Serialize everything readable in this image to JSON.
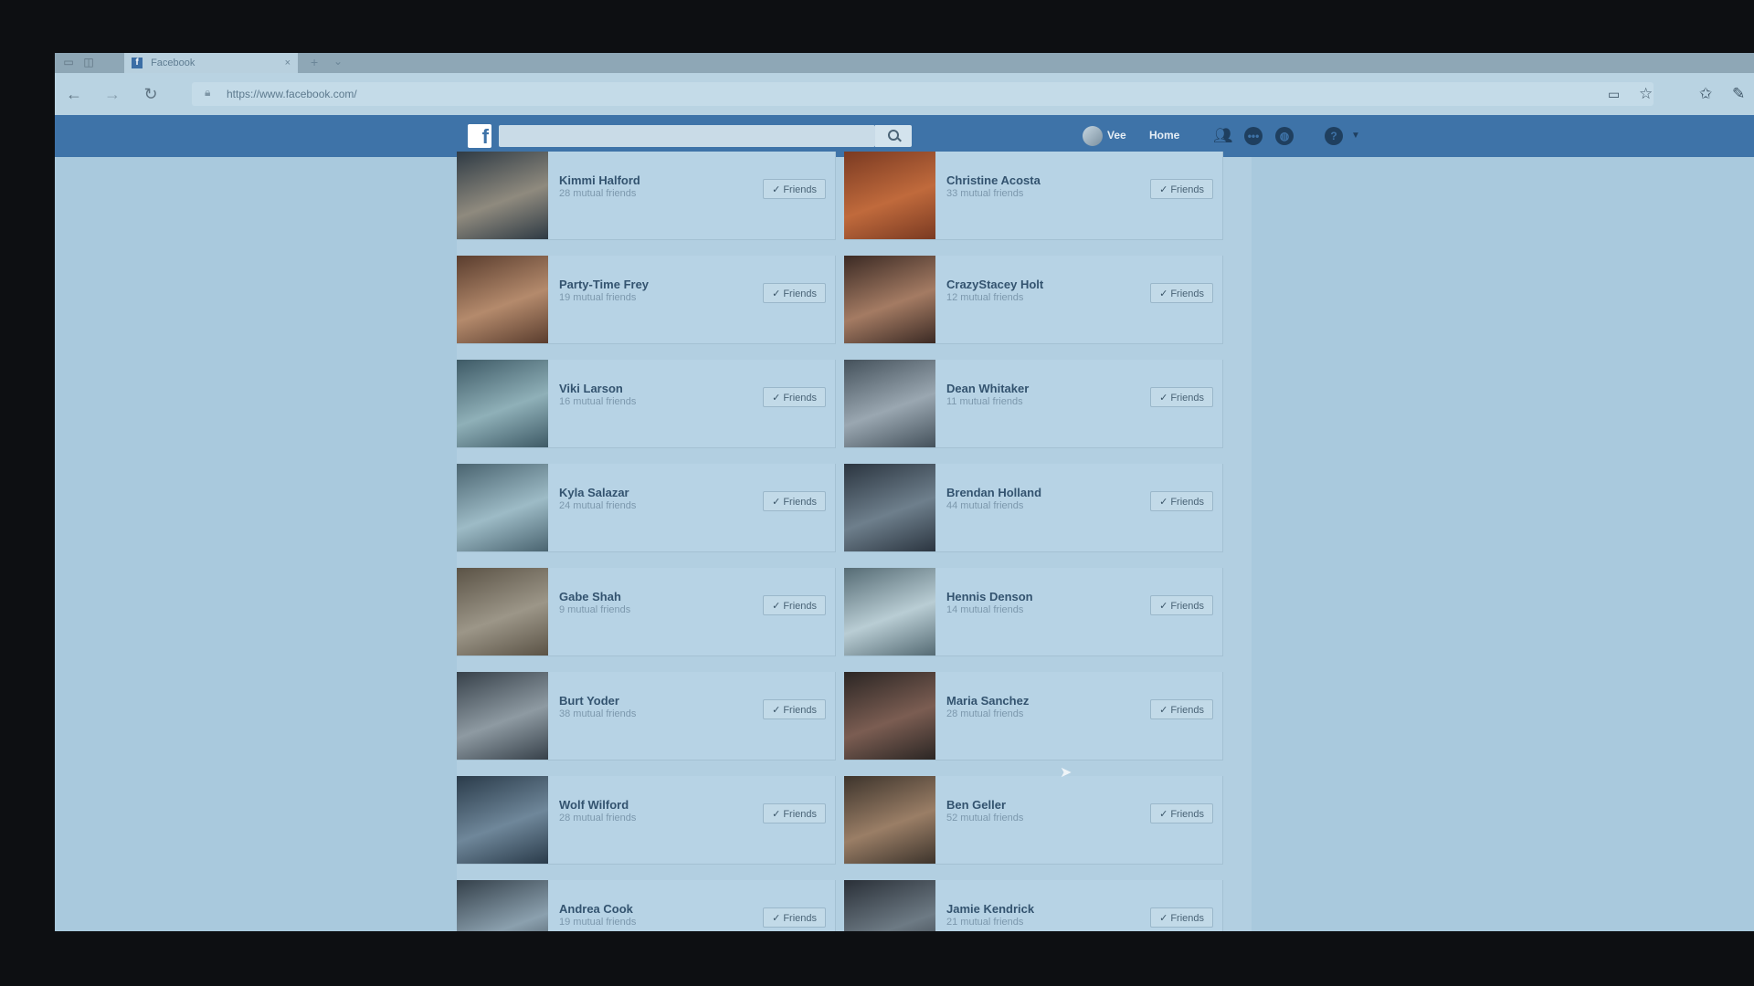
{
  "browser": {
    "tab_title": "Facebook",
    "tab_close": "×",
    "tab_new": "+",
    "tab_menu": "⌄",
    "url": "https://www.facebook.com/",
    "back": "←",
    "forward": "→",
    "reload": "↻"
  },
  "fb": {
    "logo": "f",
    "search_placeholder": "",
    "user": "Vee",
    "home": "Home"
  },
  "friends_button_label": "Friends",
  "friends": [
    {
      "name": "Kimmi Halford",
      "mutual": "28 mutual friends",
      "photo": [
        "#2e3a44",
        "#8f8a7e"
      ]
    },
    {
      "name": "Christine Acosta",
      "mutual": "33 mutual friends",
      "photo": [
        "#7a3a22",
        "#c06a3c"
      ]
    },
    {
      "name": "Party-Time Frey",
      "mutual": "19 mutual friends",
      "photo": [
        "#5a3d2e",
        "#b48a6c"
      ]
    },
    {
      "name": "CrazyStacey Holt",
      "mutual": "12 mutual friends",
      "photo": [
        "#3b2a24",
        "#a47b63"
      ]
    },
    {
      "name": "Viki Larson",
      "mutual": "16 mutual friends",
      "photo": [
        "#3e5a66",
        "#8fb0b8"
      ]
    },
    {
      "name": "Dean Whitaker",
      "mutual": "11 mutual friends",
      "photo": [
        "#44515b",
        "#9aa7b1"
      ]
    },
    {
      "name": "Kyla Salazar",
      "mutual": "24 mutual friends",
      "photo": [
        "#4a6470",
        "#9dbbc6"
      ]
    },
    {
      "name": "Brendan Holland",
      "mutual": "44 mutual friends",
      "photo": [
        "#2b3540",
        "#6e7f8c"
      ]
    },
    {
      "name": "Gabe Shah",
      "mutual": "9 mutual friends",
      "photo": [
        "#5b5346",
        "#9c9688"
      ]
    },
    {
      "name": "Hennis Denson",
      "mutual": "14 mutual friends",
      "photo": [
        "#556b74",
        "#b9cdd4"
      ]
    },
    {
      "name": "Burt Yoder",
      "mutual": "38 mutual friends",
      "photo": [
        "#37414a",
        "#8e9aa2"
      ]
    },
    {
      "name": "Maria Sanchez",
      "mutual": "28 mutual friends",
      "photo": [
        "#2b2624",
        "#7b5d52"
      ]
    },
    {
      "name": "Wolf Wilford",
      "mutual": "28 mutual friends",
      "photo": [
        "#2a3b4a",
        "#6f879a"
      ]
    },
    {
      "name": "Ben Geller",
      "mutual": "52 mutual friends",
      "photo": [
        "#3d342c",
        "#9a7e66"
      ]
    },
    {
      "name": "Andrea Cook",
      "mutual": "19 mutual friends",
      "photo": [
        "#34404a",
        "#8ba0ae"
      ]
    },
    {
      "name": "Jamie Kendrick",
      "mutual": "21 mutual friends",
      "photo": [
        "#2a3038",
        "#6d7a84"
      ]
    }
  ]
}
